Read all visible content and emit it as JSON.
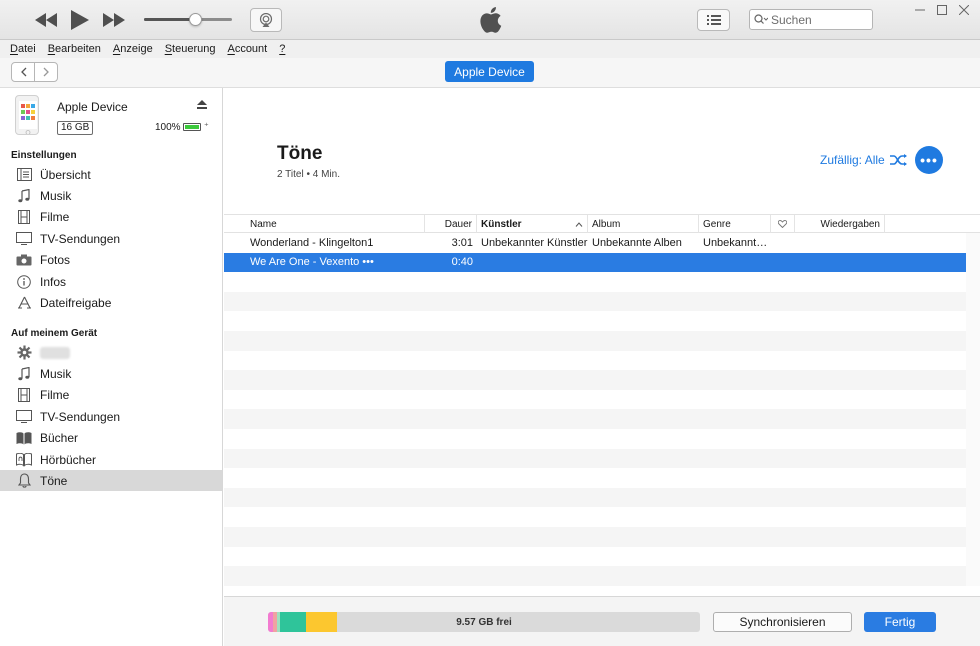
{
  "toolbar": {
    "search_placeholder": "Suchen",
    "volume_level": 0.58
  },
  "menu": [
    {
      "key": "D",
      "rest": "atei"
    },
    {
      "key": "B",
      "rest": "earbeiten"
    },
    {
      "key": "A",
      "rest": "nzeige"
    },
    {
      "key": "S",
      "rest": "teuerung"
    },
    {
      "key": "A",
      "rest": "ccount"
    },
    {
      "key": "?",
      "rest": ""
    }
  ],
  "nav": {
    "device_button": "Apple Device"
  },
  "sidebar": {
    "device": {
      "name": "Apple Device",
      "capacity": "16 GB",
      "battery": "100%",
      "battery_level": 1.0
    },
    "settings_header": "Einstellungen",
    "settings_items": [
      {
        "label": "Übersicht",
        "icon": "summary-icon"
      },
      {
        "label": "Musik",
        "icon": "music-note-icon"
      },
      {
        "label": "Filme",
        "icon": "film-icon"
      },
      {
        "label": "TV-Sendungen",
        "icon": "tv-icon"
      },
      {
        "label": "Fotos",
        "icon": "camera-icon"
      },
      {
        "label": "Infos",
        "icon": "info-icon"
      },
      {
        "label": "Dateifreigabe",
        "icon": "app-store-icon"
      }
    ],
    "device_header": "Auf meinem Gerät",
    "device_items": [
      {
        "label": "",
        "icon": "gear-icon"
      },
      {
        "label": "Musik",
        "icon": "music-note-icon"
      },
      {
        "label": "Filme",
        "icon": "film-icon"
      },
      {
        "label": "TV-Sendungen",
        "icon": "tv-icon"
      },
      {
        "label": "Bücher",
        "icon": "book-icon"
      },
      {
        "label": "Hörbücher",
        "icon": "audiobook-icon"
      },
      {
        "label": "Töne",
        "icon": "bell-icon"
      }
    ]
  },
  "main": {
    "title": "Töne",
    "subtitle": "2 Titel • 4 Min.",
    "shuffle_label": "Zufällig: Alle",
    "more_label": "•••",
    "columns": {
      "name": "Name",
      "duration": "Dauer",
      "artist": "Künstler",
      "album": "Album",
      "genre": "Genre",
      "plays": "Wiedergaben"
    },
    "rows": [
      {
        "name": "Wonderland - Klingelton1",
        "duration": "3:01",
        "artist": "Unbekannter Künstler",
        "album": "Unbekannte Alben",
        "genre": "Unbekannt…"
      },
      {
        "name": "We Are One - Vexento •••",
        "duration": "0:40",
        "artist": "",
        "album": "",
        "genre": ""
      }
    ]
  },
  "bottom": {
    "free_label": "9.57 GB frei",
    "sync_button": "Synchronisieren",
    "done_button": "Fertig",
    "storage_segments": [
      {
        "color": "#f27bd0",
        "fraction": 0.012
      },
      {
        "color": "#f0a2a2",
        "fraction": 0.008
      },
      {
        "color": "#9fe0c0",
        "fraction": 0.008
      },
      {
        "color": "#2fc49a",
        "fraction": 0.06
      },
      {
        "color": "#fcc72f",
        "fraction": 0.072
      }
    ]
  },
  "colors": {
    "accent": "#1f7ae0",
    "selection": "#2a7ce2"
  }
}
